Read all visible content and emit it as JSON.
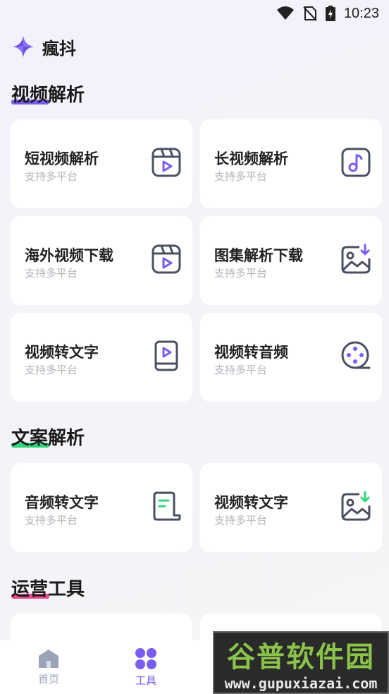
{
  "status_bar": {
    "time": "10:23"
  },
  "app": {
    "title": "瘋抖"
  },
  "sections": [
    {
      "title": "视频解析",
      "accent": "#7b5cf0",
      "cards": [
        {
          "title": "短视频解析",
          "subtitle": "支持多平台",
          "icon": "video-play-icon"
        },
        {
          "title": "长视频解析",
          "subtitle": "支持多平台",
          "icon": "music-note-icon"
        },
        {
          "title": "海外视频下载",
          "subtitle": "支持多平台",
          "icon": "video-play-icon"
        },
        {
          "title": "图集解析下载",
          "subtitle": "支持多平台",
          "icon": "image-download-icon"
        },
        {
          "title": "视频转文字",
          "subtitle": "支持多平台",
          "icon": "phone-video-icon"
        },
        {
          "title": "视频转音频",
          "subtitle": "支持多平台",
          "icon": "film-reel-icon"
        }
      ]
    },
    {
      "title": "文案解析",
      "accent": "#2fd67b",
      "cards": [
        {
          "title": "音频转文字",
          "subtitle": "支持多平台",
          "icon": "document-icon"
        },
        {
          "title": "视频转文字",
          "subtitle": "支持多平台",
          "icon": "image-download-icon"
        }
      ]
    },
    {
      "title": "运营工具",
      "accent": "#f0478f",
      "cards": []
    }
  ],
  "bottom_nav": [
    {
      "label": "首页",
      "icon": "home-icon",
      "active": false
    },
    {
      "label": "工具",
      "icon": "tools-grid-icon",
      "active": true
    }
  ],
  "watermark": {
    "text": "谷普软件园",
    "url": "www.gupuxiazai.com"
  },
  "colors": {
    "icon_stroke": "#4a4f63",
    "icon_accent": "#7b5cf0",
    "icon_green": "#2fd67b",
    "nav_active": "#7b5cf0",
    "nav_inactive": "#9aa3b8"
  }
}
